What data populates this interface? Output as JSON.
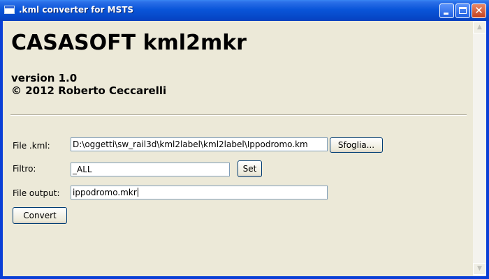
{
  "window": {
    "title": ".kml converter for MSTS",
    "icons": {
      "app": "window-icon",
      "minimize": "minimize-icon",
      "maximize": "maximize-icon",
      "close": "close-icon"
    },
    "close_glyph": "✕"
  },
  "header": {
    "app_title": "CASASOFT kml2mkr",
    "version": "version 1.0",
    "copyright": "© 2012 Roberto Ceccarelli"
  },
  "form": {
    "file_kml_label": "File .kml:",
    "file_kml_value": "D:\\oggetti\\sw_rail3d\\kml2label\\kml2label\\Ippodromo.km",
    "browse_label": "Sfoglia...",
    "filter_label": "Filtro:",
    "filter_value": "_ALL",
    "set_label": "Set",
    "output_label": "File output:",
    "output_value": "ippodromo.mkr",
    "convert_label": "Convert"
  },
  "scrollbar": {
    "up_glyph": "▲",
    "down_glyph": "▼"
  },
  "colors": {
    "titlebar": "#0a55d9",
    "background": "#ece9d8",
    "textbox_border": "#7f9db9",
    "button_border": "#003c74"
  }
}
